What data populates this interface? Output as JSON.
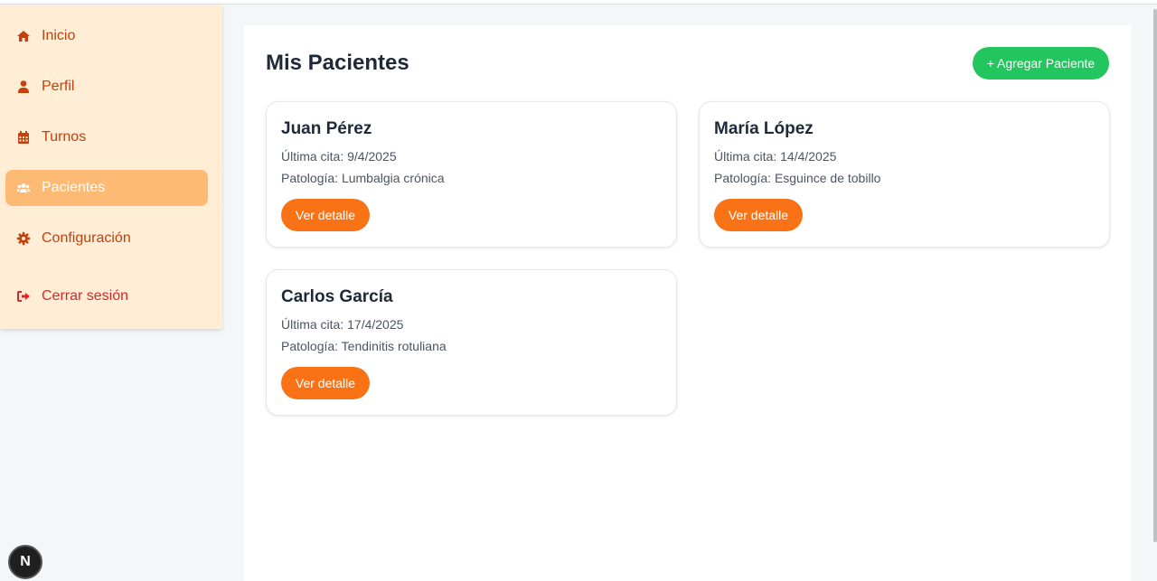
{
  "sidebar": {
    "items": [
      {
        "label": "Inicio",
        "icon": "home-icon"
      },
      {
        "label": "Perfil",
        "icon": "user-icon"
      },
      {
        "label": "Turnos",
        "icon": "calendar-icon"
      },
      {
        "label": "Pacientes",
        "icon": "users-icon",
        "active": true
      },
      {
        "label": "Configuración",
        "icon": "gear-icon"
      }
    ],
    "logout_label": "Cerrar sesión"
  },
  "main": {
    "title": "Mis Pacientes",
    "add_button_label": "+ Agregar Paciente",
    "patients": [
      {
        "name": "Juan Pérez",
        "last_visit": "Última cita: 9/4/2025",
        "pathology": "Patología: Lumbalgia crónica",
        "button": "Ver detalle"
      },
      {
        "name": "María López",
        "last_visit": "Última cita: 14/4/2025",
        "pathology": "Patología: Esguince de tobillo",
        "button": "Ver detalle"
      },
      {
        "name": "Carlos García",
        "last_visit": "Última cita: 17/4/2025",
        "pathology": "Patología: Tendinitis rotuliana",
        "button": "Ver detalle"
      }
    ]
  },
  "badge": {
    "label": "N"
  },
  "colors": {
    "sidebar_bg": "#ffedd5",
    "active_item_bg": "#fdba74",
    "accent_orange": "#f97316",
    "accent_green": "#22c55e",
    "logout_red": "#dc2626"
  }
}
